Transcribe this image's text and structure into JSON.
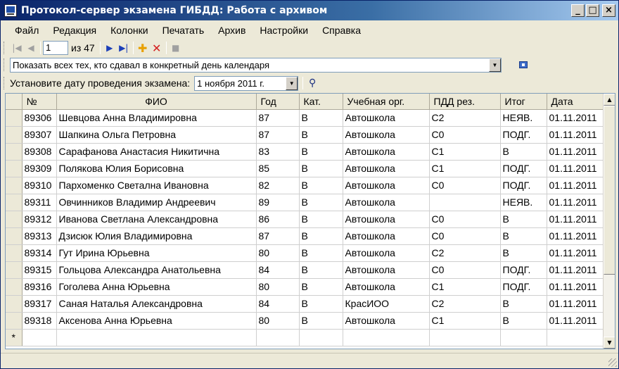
{
  "window": {
    "title": "Протокол-сервер экзамена ГИБДД: Работа с архивом"
  },
  "menu": [
    "Файл",
    "Редакция",
    "Колонки",
    "Печатать",
    "Архив",
    "Настройки",
    "Справка"
  ],
  "navigator": {
    "current_page": "1",
    "of_label": "из 47"
  },
  "filter": {
    "selected": "Показать всех тех, кто сдавал в конкретный день календаря"
  },
  "date_bar": {
    "label": "Установите дату проведения экзамена:",
    "value": "1   ноября   2011 г."
  },
  "columns": [
    "№",
    "ФИО",
    "Год",
    "Кат.",
    "Учебная орг.",
    "ПДД рез.",
    "Итог",
    "Дата"
  ],
  "rows": [
    [
      "89306",
      "Шевцова Анна Владимировна",
      "87",
      "B",
      "Автошкола",
      "C2",
      "НЕЯВ.",
      "01.11.2011"
    ],
    [
      "89307",
      "Шапкина Ольга Петровна",
      "87",
      "B",
      "Автошкола",
      "C0",
      "ПОДГ.",
      "01.11.2011"
    ],
    [
      "89308",
      "Сарафанова Анастасия Никитична",
      "83",
      "B",
      "Автошкола",
      "C1",
      "B",
      "01.11.2011"
    ],
    [
      "89309",
      "Полякова Юлия Борисовна",
      "85",
      "B",
      "Автошкола",
      "C1",
      "ПОДГ.",
      "01.11.2011"
    ],
    [
      "89310",
      "Пархоменко Светална Ивановна",
      "82",
      "B",
      "Автошкола",
      "C0",
      "ПОДГ.",
      "01.11.2011"
    ],
    [
      "89311",
      "Овчинников Владимир Андреевич",
      "89",
      "B",
      "Автошкола",
      "",
      "НЕЯВ.",
      "01.11.2011"
    ],
    [
      "89312",
      "Иванова Светлана Александровна",
      "86",
      "B",
      "Автошкола",
      "C0",
      "B",
      "01.11.2011"
    ],
    [
      "89313",
      "Дзисюк Юлия Владимировна",
      "87",
      "B",
      "Автошкола",
      "C0",
      "B",
      "01.11.2011"
    ],
    [
      "89314",
      "Гут Ирина Юрьевна",
      "80",
      "B",
      "Автошкола",
      "C2",
      "B",
      "01.11.2011"
    ],
    [
      "89315",
      "Гольцова Александра Анатольевна",
      "84",
      "B",
      "Автошкола",
      "C0",
      "ПОДГ.",
      "01.11.2011"
    ],
    [
      "89316",
      "Гоголева Анна Юрьевна",
      "80",
      "B",
      "Автошкола",
      "C1",
      "ПОДГ.",
      "01.11.2011"
    ],
    [
      "89317",
      "Саная Наталья Александровна",
      "84",
      "B",
      "КрасИОО",
      "C2",
      "B",
      "01.11.2011"
    ],
    [
      "89318",
      "Аксенова Анна Юрьевна",
      "80",
      "B",
      "Автошкола",
      "C1",
      "B",
      "01.11.2011"
    ]
  ],
  "new_row_marker": "*"
}
